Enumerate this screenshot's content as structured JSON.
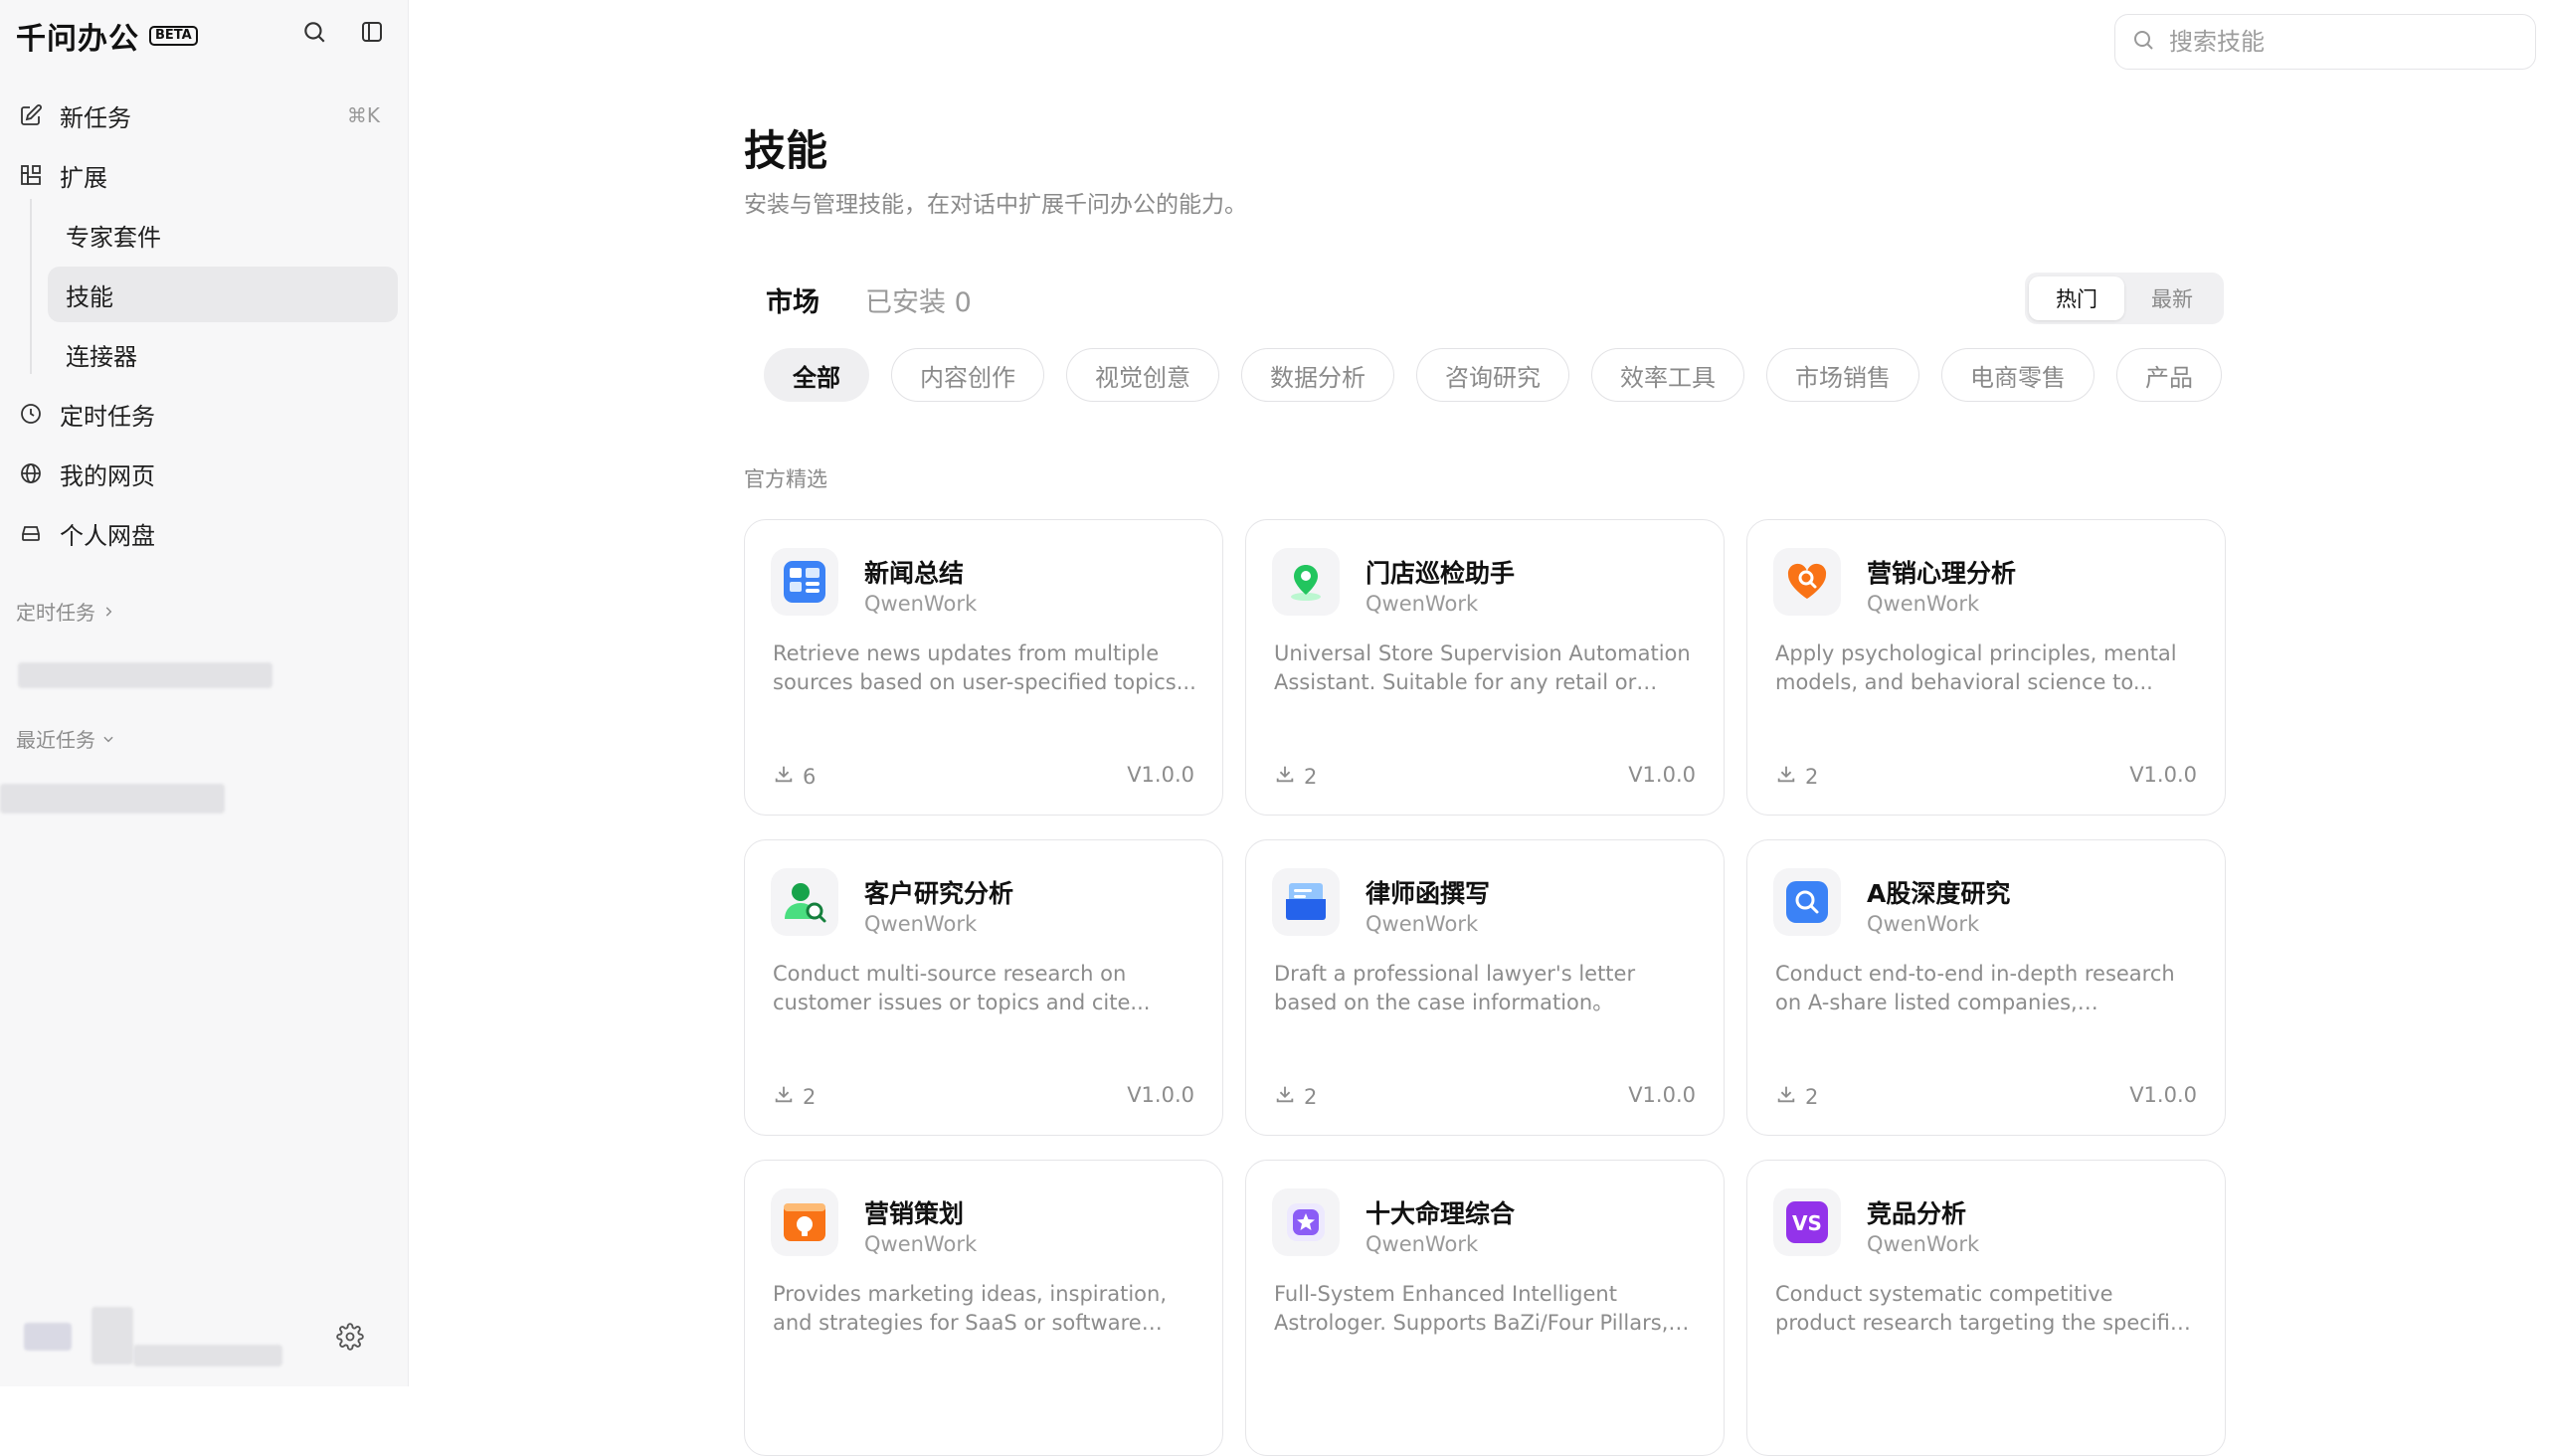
{
  "app": {
    "brand": "千问办公",
    "beta": "BETA"
  },
  "sidebar": {
    "new_task": "新任务",
    "new_task_shortcut": "⌘K",
    "extend": "扩展",
    "sub_items": [
      "专家套件",
      "技能",
      "连接器"
    ],
    "active_sub": "技能",
    "scheduled": "定时任务",
    "my_pages": "我的网页",
    "drive": "个人网盘",
    "section_scheduled": "定时任务",
    "section_recent": "最近任务"
  },
  "search": {
    "placeholder": "搜索技能"
  },
  "page": {
    "title": "技能",
    "subtitle": "安装与管理技能，在对话中扩展千问办公的能力。"
  },
  "tabs": {
    "market": "市场",
    "installed": "已安装 0"
  },
  "sort": {
    "hot": "热门",
    "new": "最新"
  },
  "categories": [
    "全部",
    "内容创作",
    "视觉创意",
    "数据分析",
    "咨询研究",
    "效率工具",
    "市场销售",
    "电商零售",
    "产品"
  ],
  "section_title": "官方精选",
  "cards": [
    {
      "name": "新闻总结",
      "author": "QwenWork",
      "desc": "Retrieve news updates from multiple sources based on user-specified topics...",
      "downloads": "6",
      "version": "V1.0.0",
      "icon": "news-icon",
      "color": "#3b82f6"
    },
    {
      "name": "门店巡检助手",
      "author": "QwenWork",
      "desc": "Universal Store Supervision Automation Assistant. Suitable for any retail or chain...",
      "downloads": "2",
      "version": "V1.0.0",
      "icon": "location-pin-icon",
      "color": "#22c55e"
    },
    {
      "name": "营销心理分析",
      "author": "QwenWork",
      "desc": "Apply psychological principles, mental models, and behavioral science to...",
      "downloads": "2",
      "version": "V1.0.0",
      "icon": "heart-search-icon",
      "color": "#f97316"
    },
    {
      "name": "客户研究分析",
      "author": "QwenWork",
      "desc": "Conduct multi-source research on customer issues or topics and cite...",
      "downloads": "2",
      "version": "V1.0.0",
      "icon": "user-search-icon",
      "color": "#16a34a"
    },
    {
      "name": "律师函撰写",
      "author": "QwenWork",
      "desc": "Draft a professional lawyer's letter based on the case information。",
      "downloads": "2",
      "version": "V1.0.0",
      "icon": "letter-icon",
      "color": "#2563eb"
    },
    {
      "name": "A股深度研究",
      "author": "QwenWork",
      "desc": "Conduct end-to-end in-depth research on A-share listed companies, automatically...",
      "downloads": "2",
      "version": "V1.0.0",
      "icon": "magnifier-icon",
      "color": "#3b82f6"
    },
    {
      "name": "营销策划",
      "author": "QwenWork",
      "desc": "Provides marketing ideas, inspiration, and strategies for SaaS or software products...",
      "downloads": "",
      "version": "",
      "icon": "lightbulb-icon",
      "color": "#f97316"
    },
    {
      "name": "十大命理综合",
      "author": "QwenWork",
      "desc": "Full-System Enhanced Intelligent Astrologer. Supports BaZi/Four Pillars, Z...",
      "downloads": "",
      "version": "",
      "icon": "star-badge-icon",
      "color": "#8b5cf6"
    },
    {
      "name": "竞品分析",
      "author": "QwenWork",
      "desc": "Conduct systematic competitive product research targeting the specified product...",
      "downloads": "",
      "version": "",
      "icon": "vs-icon",
      "color": "#9333ea"
    }
  ]
}
